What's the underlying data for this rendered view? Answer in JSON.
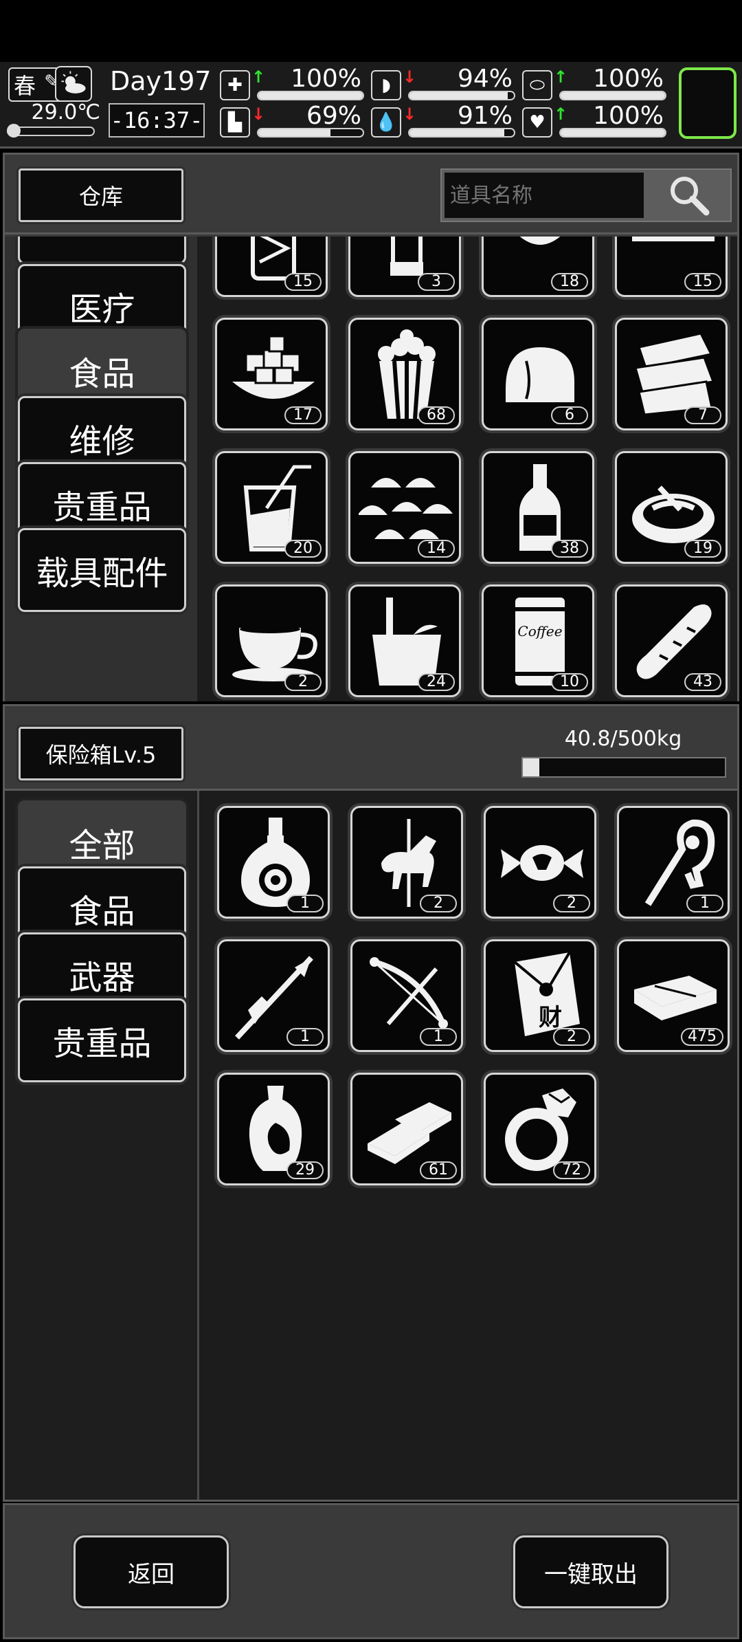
{
  "status": {
    "season": "春",
    "temperature": "29.0℃",
    "day": "Day197",
    "time": "-16:37-",
    "stats": [
      {
        "icon": "medkit-icon",
        "trend": "up",
        "value": "100%",
        "level": 1.0
      },
      {
        "icon": "stomach-icon",
        "trend": "down",
        "value": "94%",
        "level": 0.94
      },
      {
        "icon": "pill-icon",
        "trend": "up",
        "value": "100%",
        "level": 1.0
      },
      {
        "icon": "foot-icon",
        "trend": "down",
        "value": "69%",
        "level": 0.69
      },
      {
        "icon": "water-drop-icon",
        "trend": "down",
        "value": "91%",
        "level": 0.91
      },
      {
        "icon": "heart-icon",
        "trend": "up",
        "value": "100%",
        "level": 1.0
      }
    ],
    "colors": {
      "up": "#2ee52e",
      "down": "#ff2a2a",
      "equipFrame": "#7ee84a"
    }
  },
  "warehouse": {
    "title": "仓库",
    "search_placeholder": "道具名称",
    "categories": [
      {
        "label": "",
        "selected": false
      },
      {
        "label": "医疗",
        "selected": false
      },
      {
        "label": "食品",
        "selected": true
      },
      {
        "label": "维修",
        "selected": false
      },
      {
        "label": "贵重品",
        "selected": false
      },
      {
        "label": "载具配件",
        "selected": false
      }
    ],
    "items": [
      {
        "icon": "jar-icon",
        "count": "15"
      },
      {
        "icon": "can-icon",
        "count": "3"
      },
      {
        "icon": "bowl-icon",
        "count": "18"
      },
      {
        "icon": "cake-icon",
        "count": "15"
      },
      {
        "icon": "sugar-cubes-icon",
        "count": "17"
      },
      {
        "icon": "popcorn-icon",
        "count": "68"
      },
      {
        "icon": "bread-roll-icon",
        "count": "6"
      },
      {
        "icon": "sandwich-icon",
        "count": "7"
      },
      {
        "icon": "drink-cup-icon",
        "count": "20"
      },
      {
        "icon": "dumplings-icon",
        "count": "14"
      },
      {
        "icon": "liquor-bottle-icon",
        "count": "38"
      },
      {
        "icon": "soup-bowl-icon",
        "count": "19"
      },
      {
        "icon": "coffee-cup-icon",
        "count": "2"
      },
      {
        "icon": "ice-bucket-icon",
        "count": "24"
      },
      {
        "icon": "coffee-can-icon",
        "count": "10"
      },
      {
        "icon": "baguette-icon",
        "count": "43"
      }
    ],
    "coffee_can_text": "Coffee"
  },
  "safe": {
    "title": "保险箱Lv.5",
    "weight": "40.8/500kg",
    "weight_fraction": 0.0816,
    "categories": [
      {
        "label": "全部",
        "selected": true
      },
      {
        "label": "食品",
        "selected": false
      },
      {
        "label": "武器",
        "selected": false
      },
      {
        "label": "贵重品",
        "selected": false
      }
    ],
    "items": [
      {
        "icon": "cognac-bottle-icon",
        "count": "1"
      },
      {
        "icon": "carousel-horse-icon",
        "count": "2"
      },
      {
        "icon": "candy-icon",
        "count": "2"
      },
      {
        "icon": "dragon-staff-icon",
        "count": "1"
      },
      {
        "icon": "spear-icon",
        "count": "1"
      },
      {
        "icon": "crossbow-icon",
        "count": "1"
      },
      {
        "icon": "red-envelope-icon",
        "count": "2"
      },
      {
        "icon": "cash-stack-icon",
        "count": "475"
      },
      {
        "icon": "vase-icon",
        "count": "29"
      },
      {
        "icon": "gold-bars-icon",
        "count": "61"
      },
      {
        "icon": "diamond-ring-icon",
        "count": "72"
      }
    ],
    "envelope_text": "财"
  },
  "footer": {
    "back_label": "返回",
    "take_all_label": "一键取出"
  }
}
